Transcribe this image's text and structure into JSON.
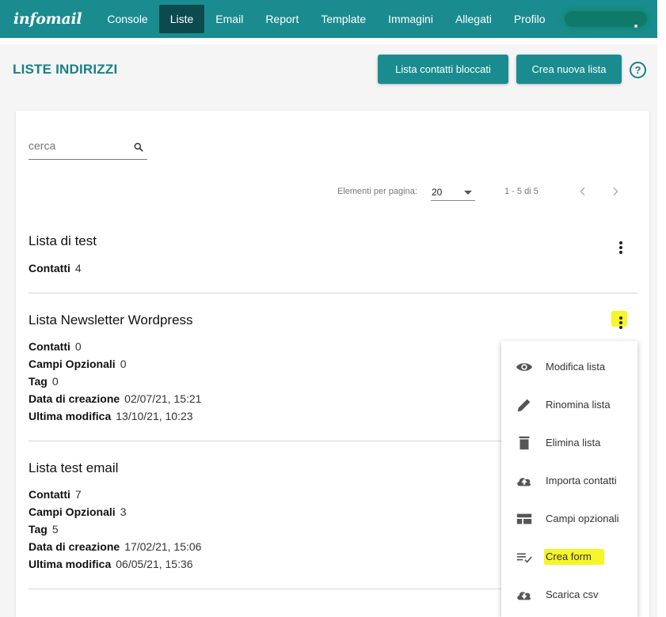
{
  "nav": {
    "logo": "infomail",
    "items": [
      "Console",
      "Liste",
      "Email",
      "Report",
      "Template",
      "Immagini",
      "Allegati",
      "Profilo"
    ],
    "active": "Liste"
  },
  "header": {
    "title": "LISTE INDIRIZZI",
    "blocked_button": "Lista contatti bloccati",
    "new_button": "Crea nuova lista",
    "help": "?"
  },
  "search": {
    "placeholder": "cerca"
  },
  "pagination": {
    "label": "Elementi per pagina:",
    "per_page": "20",
    "range": "1 - 5 di 5"
  },
  "lists": [
    {
      "title": "Lista di test",
      "fields": [
        {
          "label": "Contatti",
          "value": "4"
        }
      ]
    },
    {
      "title": "Lista Newsletter Wordpress",
      "fields": [
        {
          "label": "Contatti",
          "value": "0"
        },
        {
          "label": "Campi Opzionali",
          "value": "0"
        },
        {
          "label": "Tag",
          "value": "0"
        },
        {
          "label": "Data di creazione",
          "value": "02/07/21, 15:21"
        },
        {
          "label": "Ultima modifica",
          "value": "13/10/21, 10:23"
        }
      ]
    },
    {
      "title": "Lista test email",
      "fields": [
        {
          "label": "Contatti",
          "value": "7"
        },
        {
          "label": "Campi Opzionali",
          "value": "3"
        },
        {
          "label": "Tag",
          "value": "5"
        },
        {
          "label": "Data di creazione",
          "value": "17/02/21, 15:06"
        },
        {
          "label": "Ultima modifica",
          "value": "06/05/21, 15:36"
        }
      ]
    }
  ],
  "menu": {
    "items": [
      {
        "label": "Modifica lista",
        "icon": "eye-icon"
      },
      {
        "label": "Rinomina lista",
        "icon": "pencil-icon"
      },
      {
        "label": "Elimina lista",
        "icon": "trash-icon"
      },
      {
        "label": "Importa contatti",
        "icon": "cloud-upload-icon"
      },
      {
        "label": "Campi opzionali",
        "icon": "table-icon"
      },
      {
        "label": "Crea form",
        "icon": "playlist-check-icon"
      },
      {
        "label": "Scarica csv",
        "icon": "cloud-download-icon"
      }
    ]
  },
  "colors": {
    "primary": "#1a8c8f",
    "active_nav": "#0c4a4e",
    "highlight": "#f5f52a"
  }
}
